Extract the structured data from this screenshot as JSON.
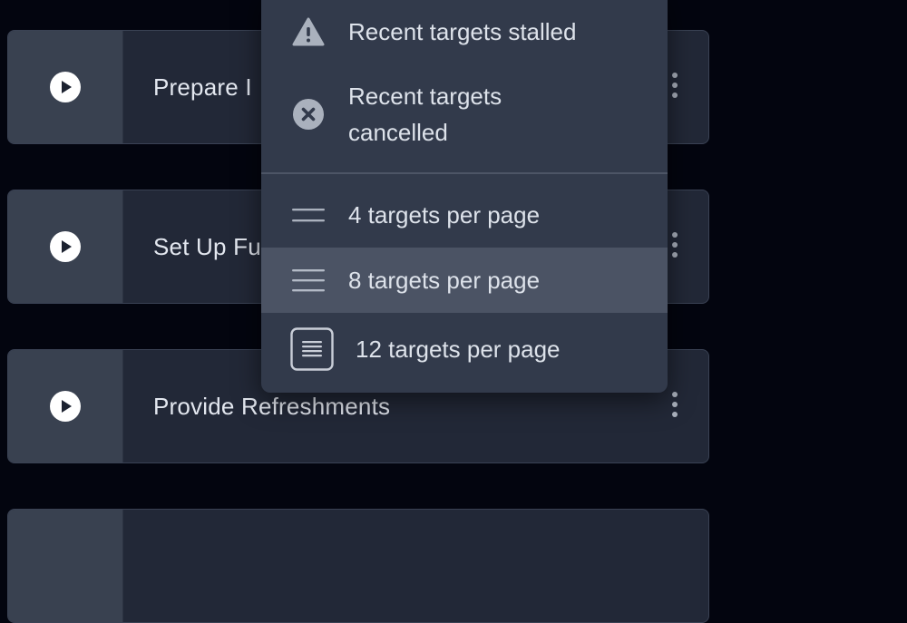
{
  "cards": [
    {
      "label": "Prepare I",
      "play_icon": "play-circle-icon",
      "more_icon": "kebab-menu-icon"
    },
    {
      "label": "Set Up Fu",
      "play_icon": "play-circle-icon",
      "more_icon": "kebab-menu-icon"
    },
    {
      "label": "Provide Refreshments",
      "play_icon": "play-circle-icon",
      "more_icon": "kebab-menu-icon"
    },
    {
      "label": "",
      "play_icon": "",
      "more_icon": ""
    }
  ],
  "menu": {
    "items": [
      {
        "label": "Recent targets stalled",
        "icon": "warning-triangle-icon"
      },
      {
        "label": "Recent targets cancelled",
        "icon": "cancel-circle-icon"
      },
      {
        "label": "4 targets per page",
        "icon": "two-lines-icon"
      },
      {
        "label": "8 targets per page",
        "icon": "three-lines-icon",
        "highlighted": true
      },
      {
        "label": "12 targets per page",
        "icon": "list-box-icon"
      }
    ]
  },
  "colors": {
    "background": "#03050f",
    "card": "#222837",
    "card_play_zone": "#394150",
    "menu": "#323a4b",
    "menu_highlight": "#4b5364",
    "text": "#e3e7ef"
  }
}
